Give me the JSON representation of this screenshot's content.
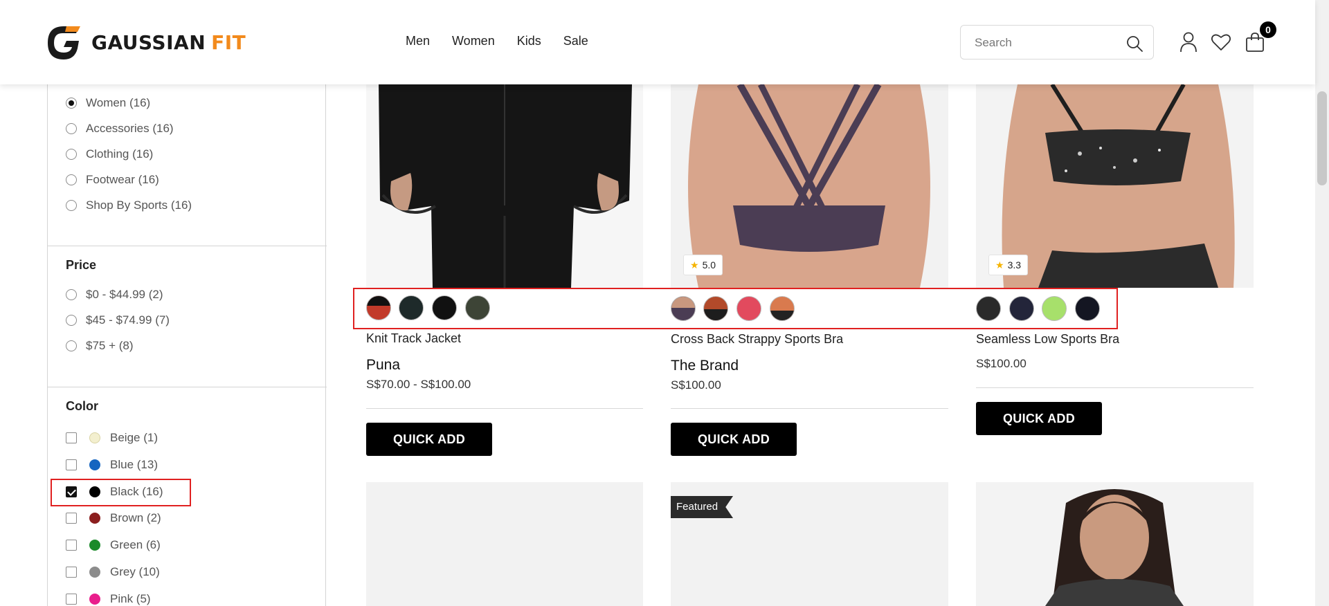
{
  "header": {
    "logo_main": "GAUSSIAN",
    "logo_accent": "FIT",
    "nav": [
      "Men",
      "Women",
      "Kids",
      "Sale"
    ],
    "search_placeholder": "Search",
    "cart_count": "0"
  },
  "sidebar": {
    "categories": [
      {
        "label": "Women (16)",
        "selected": true
      },
      {
        "label": "Accessories (16)",
        "selected": false
      },
      {
        "label": "Clothing (16)",
        "selected": false
      },
      {
        "label": "Footwear (16)",
        "selected": false
      },
      {
        "label": "Shop By Sports (16)",
        "selected": false
      }
    ],
    "price_title": "Price",
    "prices": [
      "$0 - $44.99 (2)",
      "$45 - $74.99 (7)",
      "$75 + (8)"
    ],
    "color_title": "Color",
    "colors": [
      {
        "label": "Beige (1)",
        "hex": "#f3efcf",
        "checked": false
      },
      {
        "label": "Blue (13)",
        "hex": "#1565c0",
        "checked": false
      },
      {
        "label": "Black (16)",
        "hex": "#000000",
        "checked": true
      },
      {
        "label": "Brown (2)",
        "hex": "#8b1e1e",
        "checked": false
      },
      {
        "label": "Green (6)",
        "hex": "#1b8a2a",
        "checked": false
      },
      {
        "label": "Grey (10)",
        "hex": "#8c8c8c",
        "checked": false
      },
      {
        "label": "Pink (5)",
        "hex": "#e91e8c",
        "checked": false
      }
    ]
  },
  "products": [
    {
      "name": "Knit Track Jacket",
      "brand": "Puna",
      "price": "S$70.00 - S$100.00",
      "button": "QUICK ADD",
      "swatches": [
        "#c23a2a",
        "#1e2a2a",
        "#111111",
        "#3d4436"
      ]
    },
    {
      "name": "Cross Back Strappy Sports Bra",
      "brand": "The Brand",
      "price": "S$100.00",
      "button": "QUICK ADD",
      "rating": "5.0",
      "swatches": [
        "#4b3d54",
        "#b24a2a",
        "#e24a5e",
        "#d97a4e"
      ]
    },
    {
      "name": "Seamless Low Sports Bra",
      "brand": "",
      "price": "S$100.00",
      "button": "QUICK ADD",
      "rating": "3.3",
      "swatches": [
        "#2a2a2a",
        "#23253a",
        "#a7e06b",
        "#141622"
      ]
    }
  ],
  "featured_label": "Featured",
  "colors": {
    "accent": "#f28a1c",
    "highlight": "#e02020",
    "button": "#000000"
  }
}
